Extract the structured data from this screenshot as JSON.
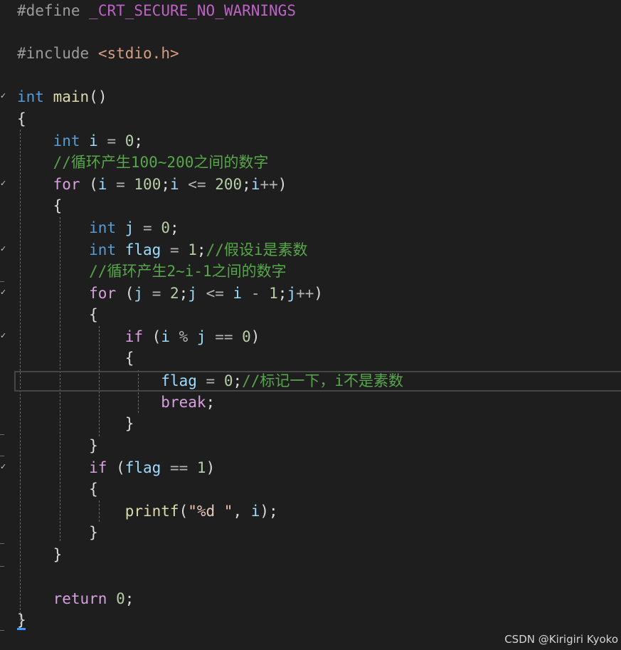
{
  "watermark": "CSDN @Kirigiri Kyoko",
  "code": {
    "l1_pp": "#define",
    "l1_macro": "_CRT_SECURE_NO_WARNINGS",
    "l3_pp": "#include",
    "l3_inc": "<stdio.h>",
    "l5_kw": "int",
    "l5_fn": "main",
    "l5_punc": "()",
    "l6_brace": "{",
    "l7_kw": "int",
    "l7_var": "i",
    "l7_eq": " = ",
    "l7_num": "0",
    "l7_semi": ";",
    "l8_cmt": "//循环产生100~200之间的数字",
    "l9_kw": "for",
    "l9_p1": " (",
    "l9_v1": "i",
    "l9_eq": " = ",
    "l9_n1": "100",
    "l9_s1": ";",
    "l9_v2": "i",
    "l9_le": " <= ",
    "l9_n2": "200",
    "l9_s2": ";",
    "l9_v3": "i",
    "l9_pp": "++",
    "l9_p2": ")",
    "l10_brace": "{",
    "l11_kw": "int",
    "l11_var": "j",
    "l11_eq": " = ",
    "l11_num": "0",
    "l11_semi": ";",
    "l12_kw": "int",
    "l12_var": "flag",
    "l12_eq": " = ",
    "l12_num": "1",
    "l12_semi": ";",
    "l12_cmt": "//假设i是素数",
    "l13_cmt": "//循环产生2~i-1之间的数字",
    "l14_kw": "for",
    "l14_p1": " (",
    "l14_v1": "j",
    "l14_eq": " = ",
    "l14_n1": "2",
    "l14_s1": ";",
    "l14_v2": "j",
    "l14_le": " <= ",
    "l14_v3": "i",
    "l14_minus": " - ",
    "l14_n2": "1",
    "l14_s2": ";",
    "l14_v4": "j",
    "l14_pp": "++",
    "l14_p2": ")",
    "l15_brace": "{",
    "l16_kw": "if",
    "l16_p1": " (",
    "l16_v1": "i",
    "l16_mod": " % ",
    "l16_v2": "j",
    "l16_eqeq": " == ",
    "l16_num": "0",
    "l16_p2": ")",
    "l17_brace": "{",
    "l18_var": "flag",
    "l18_eq": " = ",
    "l18_num": "0",
    "l18_semi": ";",
    "l18_cmt": "//标记一下，i不是素数",
    "l19_kw": "break",
    "l19_semi": ";",
    "l20_brace": "}",
    "l21_brace": "}",
    "l22_kw": "if",
    "l22_p1": " (",
    "l22_var": "flag",
    "l22_eqeq": " == ",
    "l22_num": "1",
    "l22_p2": ")",
    "l23_brace": "{",
    "l24_fn": "printf",
    "l24_p1": "(",
    "l24_str": "\"%d \"",
    "l24_comma": ", ",
    "l24_var": "i",
    "l24_p2": ");",
    "l25_brace": "}",
    "l26_brace": "}",
    "l28_kw": "return",
    "l28_num": " 0",
    "l28_semi": ";",
    "l29_brace": "}"
  }
}
